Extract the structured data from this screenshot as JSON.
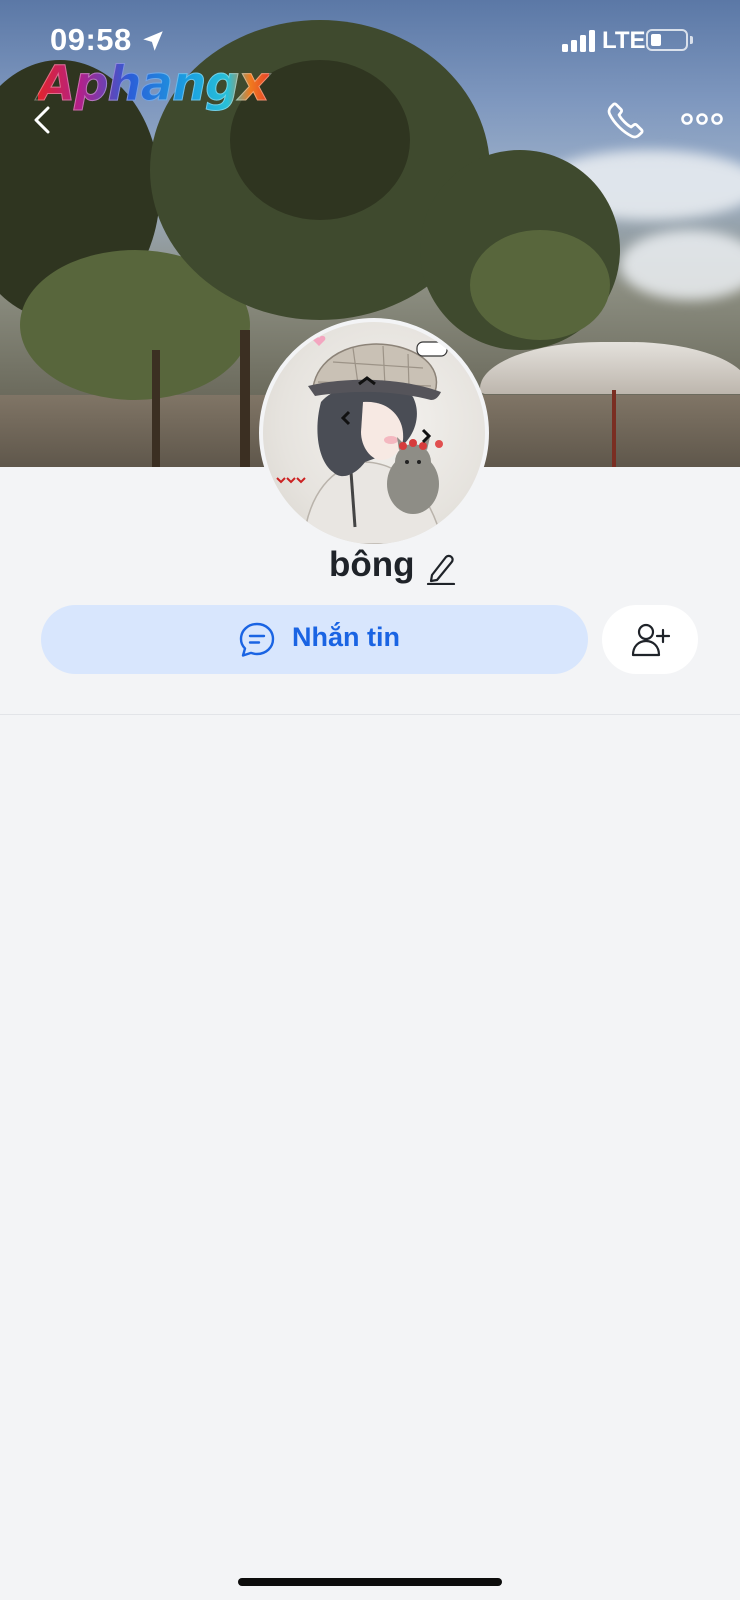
{
  "status_bar": {
    "time": "09:58",
    "network": "LTE",
    "battery_level": 0.3,
    "signal_bars": 4
  },
  "watermark": "Aphangx",
  "header": {
    "back_icon": "chevron-left-icon",
    "call_icon": "phone-icon",
    "more_icon": "more-horizontal-icon"
  },
  "profile": {
    "name": "bông",
    "edit_icon": "pencil-icon"
  },
  "actions": {
    "message_label": "Nhắn tin",
    "message_icon": "chat-bubble-icon",
    "add_friend_icon": "add-user-icon"
  },
  "colors": {
    "primary": "#1a64e3",
    "primary_light": "#d8e6fd",
    "background": "#f3f4f6"
  }
}
